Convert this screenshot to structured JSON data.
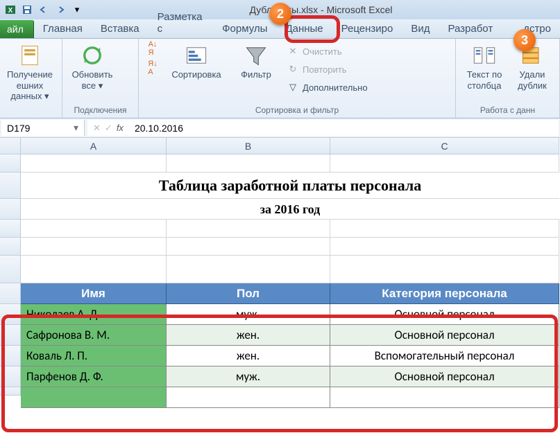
{
  "title": "Дубликаты.xlsx - Microsoft Excel",
  "qat": {
    "save": "save",
    "undo": "undo",
    "redo": "redo"
  },
  "tabs": {
    "file": "айл",
    "items": [
      "Главная",
      "Вставка",
      "Разметка с",
      "Формулы",
      "Данные",
      "Рецензиро",
      "Вид",
      "Разработ",
      "дстро"
    ],
    "active_index": 4
  },
  "ribbon": {
    "group1": {
      "btn1": "Получение\nешних данных",
      "label": ""
    },
    "group2": {
      "btn1": "Обновить\nвсе",
      "label": "Подключения"
    },
    "group3": {
      "sort_asc": "А↓Я",
      "sort_desc": "Я↓А",
      "sort": "Сортировка",
      "filter": "Фильтр",
      "clear": "Очистить",
      "reapply": "Повторить",
      "advanced": "Дополнительно",
      "label": "Сортировка и фильтр"
    },
    "group4": {
      "btn1": "Текст по\nстолбца",
      "btn2": "Удали\nдублик",
      "label": "Работа с данн"
    }
  },
  "namebox": "D179",
  "formula": "20.10.2016",
  "columns": [
    "A",
    "B",
    "C"
  ],
  "sheet": {
    "title": "Таблица заработной платы персонала",
    "subtitle": "за 2016 год",
    "headers": [
      "Имя",
      "Пол",
      "Категория персонала"
    ],
    "rows": [
      {
        "name": "Николаев А. Д.",
        "sex": "муж.",
        "cat": "Основной персонал"
      },
      {
        "name": "Сафронова В. М.",
        "sex": "жен.",
        "cat": "Основной персонал"
      },
      {
        "name": "Коваль Л. П.",
        "sex": "жен.",
        "cat": "Вспомогательный персонал"
      },
      {
        "name": "Парфенов Д. Ф.",
        "sex": "муж.",
        "cat": "Основной персонал"
      }
    ]
  },
  "callouts": {
    "c2": "2",
    "c3": "3"
  }
}
